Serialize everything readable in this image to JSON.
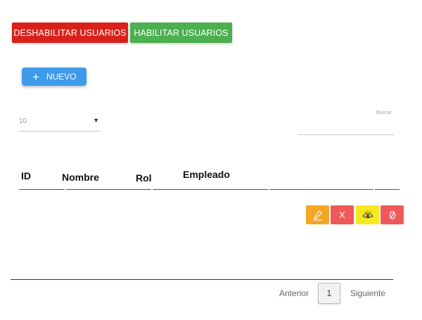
{
  "toolbar": {
    "disable_label": "DESHABILITAR USUARIOS",
    "enable_label": "HABILITAR USUARIOS",
    "new_icon": "+",
    "new_label": "NUEVO"
  },
  "filters": {
    "page_size": "10",
    "page_size_caret": "▼",
    "search_label": "Buscar",
    "search_value": ""
  },
  "table": {
    "columns": [
      "ID",
      "Nombre",
      "Rol",
      "Empleado"
    ],
    "actions": {
      "delete_label": "X"
    }
  },
  "pagination": {
    "prev": "Anterior",
    "current": "1",
    "next": "Siguiente"
  },
  "colors": {
    "disable": "#d9211b",
    "enable": "#4caf50",
    "new": "#3d9be9",
    "edit": "#f5a623",
    "delete": "#f0595a",
    "view": "#f5e91e",
    "block": "#f0595a"
  },
  "icons": {
    "new": "plus-icon",
    "edit": "pencil-icon",
    "view": "eye-icon",
    "block": "block-icon",
    "dropdown": "caret-down-icon"
  }
}
